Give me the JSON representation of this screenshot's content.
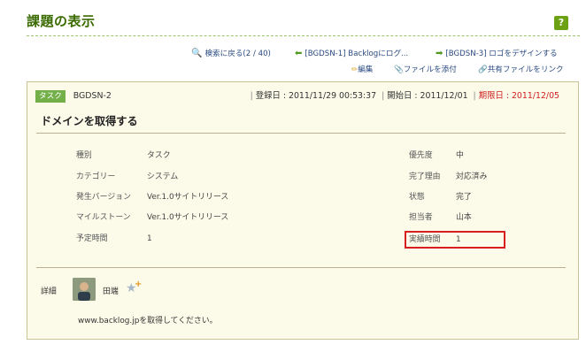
{
  "header": {
    "title": "課題の表示",
    "help_label": "?"
  },
  "nav": {
    "back_search": "検索に戻る(2 / 40)",
    "prev_issue": "[BGDSN-1] Backlogにログ...",
    "next_issue": "[BGDSN-3] ロゴをデザインする"
  },
  "actions": {
    "edit": "編集",
    "attach": "ファイルを添付",
    "link_shared": "共有ファイルをリンク"
  },
  "issue": {
    "type_badge": "タスク",
    "key": "BGDSN-2",
    "registered": "登録日 : 2011/11/29 00:53:37",
    "start": "開始日 : 2011/12/01",
    "due": "期限日 : 2011/12/05",
    "summary": "ドメインを取得する",
    "fields_left": [
      {
        "label": "種別",
        "value": "タスク"
      },
      {
        "label": "カテゴリー",
        "value": "システム"
      },
      {
        "label": "発生バージョン",
        "value": "Ver.1.0サイトリリース"
      },
      {
        "label": "マイルストーン",
        "value": "Ver.1.0サイトリリース"
      },
      {
        "label": "予定時間",
        "value": "1"
      }
    ],
    "fields_right": [
      {
        "label": "優先度",
        "value": "中"
      },
      {
        "label": "完了理由",
        "value": "対応済み"
      },
      {
        "label": "状態",
        "value": "完了"
      },
      {
        "label": "担当者",
        "value": "山本"
      },
      {
        "label": "実績時間",
        "value": "1"
      }
    ],
    "detail_label": "詳細",
    "author": "田端",
    "description": "www.backlog.jpを取得してください。"
  },
  "colors": {
    "accent": "#6ba112",
    "highlight": "#d81e1e",
    "due": "#d02020"
  }
}
